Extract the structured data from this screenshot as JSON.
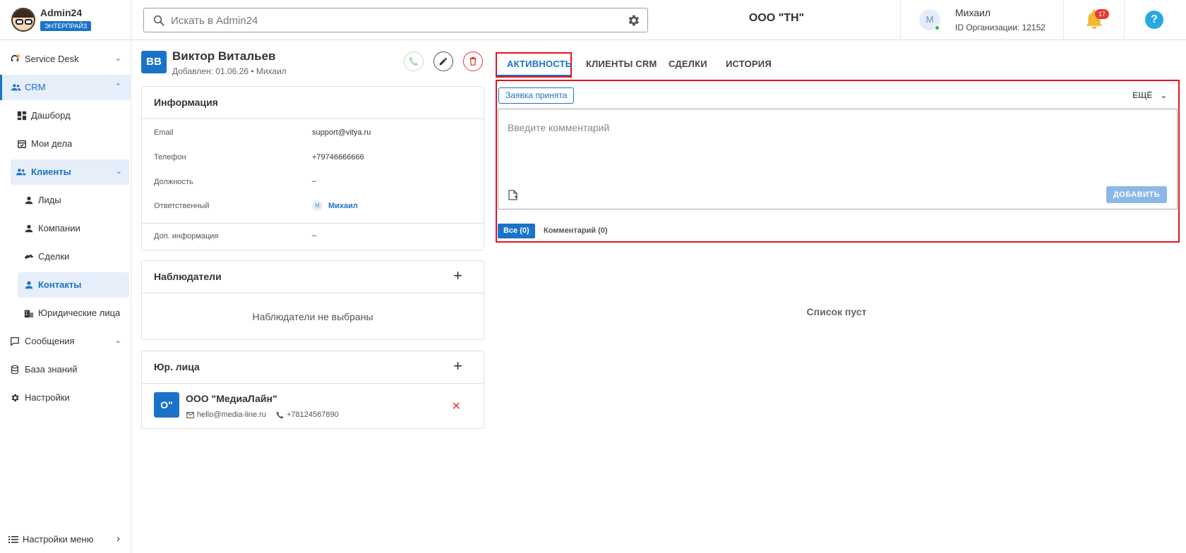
{
  "header": {
    "app_name": "Admin24",
    "plan_badge": "ЭНТЕРПРАЙЗ",
    "search_placeholder": "Искать в Admin24",
    "org_name": "ООО \"ТН\"",
    "user_initial": "М",
    "user_name": "Михаил",
    "user_org": "ID Организации: 12152",
    "notifications": "17",
    "help_symbol": "?"
  },
  "sidebar": {
    "items": [
      {
        "label": "Service Desk"
      },
      {
        "label": "CRM"
      },
      {
        "label": "Дашборд"
      },
      {
        "label": "Мои дела"
      },
      {
        "label": "Клиенты"
      },
      {
        "label": "Лиды"
      },
      {
        "label": "Компании"
      },
      {
        "label": "Сделки"
      },
      {
        "label": "Контакты"
      },
      {
        "label": "Юридические лица"
      },
      {
        "label": "Сообщения"
      },
      {
        "label": "База знаний"
      },
      {
        "label": "Настройки"
      }
    ],
    "menu_settings": "Настройки меню"
  },
  "contact": {
    "initials": "ВВ",
    "name": "Виктор Витальев",
    "added": "Добавлен: 01.06.26 • Михаил",
    "info": {
      "title": "Информация",
      "email_label": "Email",
      "email": "support@vitya.ru",
      "phone_label": "Телефон",
      "phone": "+79746666666",
      "position_label": "Должность",
      "position": "–",
      "responsible_label": "Ответственный",
      "responsible_initial": "М",
      "responsible": "Михаил",
      "extra_label": "Доп. информация",
      "extra": "–"
    },
    "observers": {
      "title": "Наблюдатели",
      "empty": "Наблюдатели не выбраны"
    },
    "legal": {
      "title": "Юр. лица",
      "initials": "О\"",
      "name": "ООО \"МедиаЛайн\"",
      "email": "hello@media-line.ru",
      "phone": "+78124567890"
    }
  },
  "tabs": [
    "АКТИВНОСТЬ",
    "КЛИЕНТЫ CRM",
    "СДЕЛКИ",
    "ИСТОРИЯ"
  ],
  "activity": {
    "chip": "Заявка принята",
    "more": "ЕЩЁ",
    "placeholder": "Введите комментарий",
    "add_button": "ДОБАВИТЬ",
    "filter_all": "Все (0)",
    "filter_comments": "Комментарий (0)",
    "empty": "Список пуст"
  },
  "colors": {
    "accent": "#1a73c9",
    "highlight": "#e0151f",
    "danger": "#e53935"
  }
}
